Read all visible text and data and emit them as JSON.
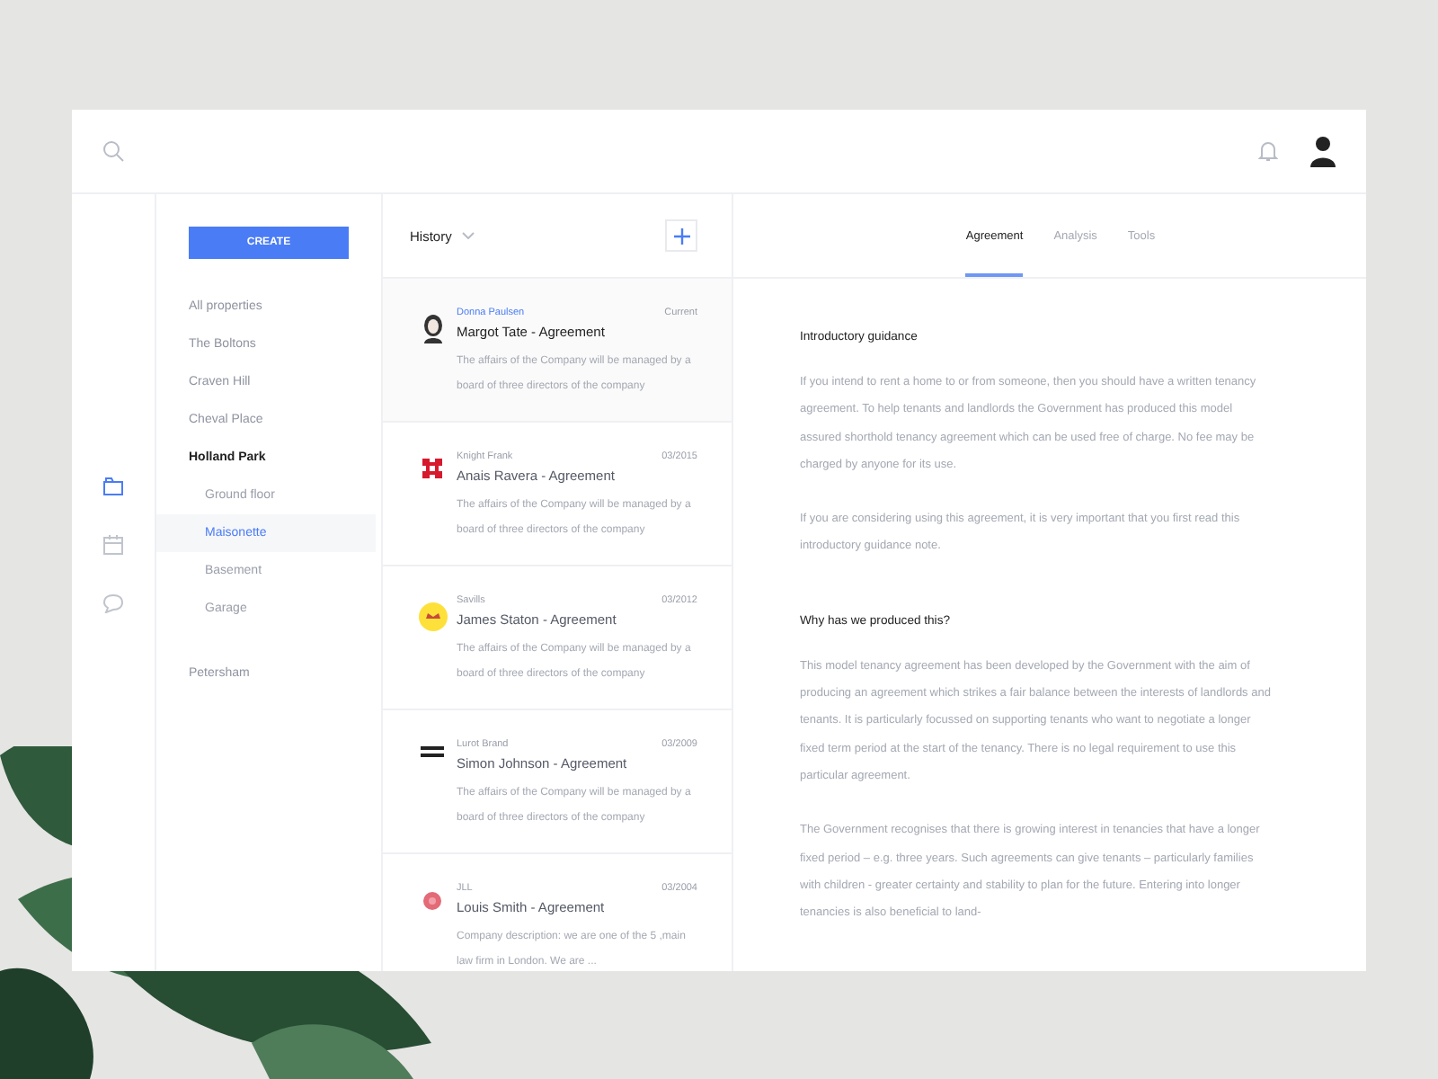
{
  "rail": [
    {
      "kind": "folder",
      "selected": true
    },
    {
      "kind": "calendar",
      "selected": false
    },
    {
      "kind": "chat",
      "selected": false
    }
  ],
  "sidebar": {
    "create_button": "CREATE",
    "properties": [
      {
        "label": "All properties",
        "expanded": false,
        "selected": false
      },
      {
        "label": "The Boltons",
        "expanded": false,
        "selected": false
      },
      {
        "label": "Craven Hill",
        "expanded": false,
        "selected": false
      },
      {
        "label": "Cheval Place",
        "expanded": false,
        "selected": false
      },
      {
        "label": "Holland Park",
        "expanded": true,
        "selected": false,
        "children": [
          {
            "label": "Ground floor",
            "selected": false
          },
          {
            "label": "Maisonette",
            "selected": true
          },
          {
            "label": "Basement",
            "selected": false
          },
          {
            "label": "Garage",
            "selected": false
          }
        ]
      },
      {
        "label": "Petersham",
        "expanded": false,
        "selected": false
      }
    ]
  },
  "history": {
    "title": "History",
    "documents": [
      {
        "kind": "portrait",
        "company": "Donna Paulsen",
        "date": "Current",
        "title": "Margot Tate - Agreement",
        "description": "The affairs of the Company will be managed by a board of three directors of the company",
        "selected": true
      },
      {
        "kind": "cross",
        "company": "Knight Frank",
        "date": "03/2015",
        "title": "Anais Ravera - Agreement",
        "description": "The affairs of the Company will be managed by a board of three directors of the company",
        "selected": false
      },
      {
        "kind": "circle",
        "company": "Savills",
        "date": "03/2012",
        "title": "James Staton - Agreement",
        "description": "The affairs of the Company will be managed by a board of three directors of the company",
        "selected": false
      },
      {
        "kind": "wordmark",
        "company": "Lurot Brand",
        "date": "03/2009",
        "title": "Simon Johnson - Agreement",
        "description": "The affairs of the Company will be managed by a board of three directors of the company",
        "selected": false
      },
      {
        "kind": "flower",
        "company": "JLL",
        "date": "03/2004",
        "title": "Louis Smith - Agreement",
        "description": "Company description: we are one of the 5 ,main law firm in London. We are ...",
        "selected": false
      }
    ]
  },
  "tabs": [
    {
      "label": "Agreement",
      "selected": true
    },
    {
      "label": "Analysis",
      "selected": false
    },
    {
      "label": "Tools",
      "selected": false
    }
  ],
  "document": {
    "sections": [
      {
        "heading": "Introductory guidance",
        "paragraphs": [
          "If you intend to rent a home to or from someone, then you should have a written tenancy agreement.  To help tenants and landlords the Government has produced this model assured shorthold tenancy agreement which can be used free of charge. No fee may be charged by anyone for its use.",
          "If you are considering using this agreement, it is very important that you first read this introductory guidance note."
        ]
      },
      {
        "heading": "Why has we produced this?",
        "paragraphs": [
          "This model tenancy agreement has been developed by the Government with the aim of producing an agreement which strikes a fair balance between the interests of landlords and tenants. It is particularly focussed on supporting tenants who want to negotiate a longer fixed term period at the start of the tenancy. There is no legal requirement to use this particular agreement.",
          "The Government recognises that there is growing interest in tenancies that have a longer fixed period – e.g. three years.  Such agreements can give tenants – particularly families with children - greater certainty and stability to plan for the future. Entering into longer tenancies is also beneficial to land-"
        ]
      }
    ]
  }
}
